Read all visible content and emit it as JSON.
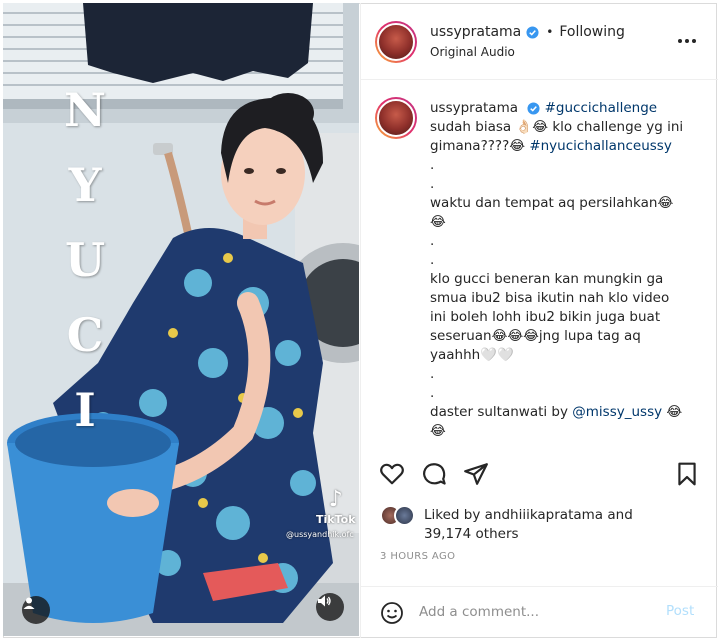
{
  "media": {
    "overlay_letters": [
      "N",
      "Y",
      "U",
      "C",
      "I"
    ],
    "tiktok_label": "TikTok",
    "tiktok_handle": "@ussyandhik.ofc",
    "icons": {
      "user": "user-tag-icon",
      "sound": "sound-icon"
    }
  },
  "header": {
    "username": "ussypratama",
    "separator": "•",
    "follow_label": "Following",
    "audio": "Original Audio",
    "icons": {
      "verified": "verified-badge-icon",
      "more": "more-options-icon"
    }
  },
  "caption": {
    "username": "ussypratama",
    "lines": [
      {
        "parts": [
          {
            "text": "",
            "tag": false
          },
          {
            "text": "#guccichallenge",
            "tag": true
          }
        ]
      },
      {
        "parts": [
          {
            "text": "sudah biasa 👌🏻😂 klo challenge yg ini",
            "tag": false
          }
        ]
      },
      {
        "parts": [
          {
            "text": "gimana????😂 ",
            "tag": false
          },
          {
            "text": "#nyucichallanceussy",
            "tag": true
          }
        ]
      },
      {
        "parts": [
          {
            "text": ".",
            "tag": false
          }
        ]
      },
      {
        "parts": [
          {
            "text": ".",
            "tag": false
          }
        ]
      },
      {
        "parts": [
          {
            "text": "waktu dan tempat aq persilahkan😂",
            "tag": false
          }
        ]
      },
      {
        "parts": [
          {
            "text": "😂",
            "tag": false
          }
        ]
      },
      {
        "parts": [
          {
            "text": ".",
            "tag": false
          }
        ]
      },
      {
        "parts": [
          {
            "text": ".",
            "tag": false
          }
        ]
      },
      {
        "parts": [
          {
            "text": "klo gucci beneran kan mungkin ga",
            "tag": false
          }
        ]
      },
      {
        "parts": [
          {
            "text": "smua ibu2 bisa ikutin nah klo video",
            "tag": false
          }
        ]
      },
      {
        "parts": [
          {
            "text": "ini boleh lohh ibu2 bikin juga buat",
            "tag": false
          }
        ]
      },
      {
        "parts": [
          {
            "text": "seseruan😂😂😂jng lupa tag aq",
            "tag": false
          }
        ]
      },
      {
        "parts": [
          {
            "text": "yaahhh🤍🤍",
            "tag": false
          }
        ]
      },
      {
        "parts": [
          {
            "text": ".",
            "tag": false
          }
        ]
      },
      {
        "parts": [
          {
            "text": ".",
            "tag": false
          }
        ]
      },
      {
        "parts": [
          {
            "text": "daster sultanwati by ",
            "tag": false
          },
          {
            "text": "@missy_ussy",
            "tag": true
          },
          {
            "text": " 😂",
            "tag": false
          }
        ]
      },
      {
        "parts": [
          {
            "text": "😂",
            "tag": false
          }
        ]
      }
    ]
  },
  "actions": {
    "icons": [
      "like-heart-icon",
      "comment-icon",
      "share-icon",
      "save-bookmark-icon"
    ]
  },
  "likes": {
    "prefix": "Liked by ",
    "user": "andhiiikapratama",
    "connector": " and",
    "count_text": "39,174 others"
  },
  "time_ago": "3 HOURS AGO",
  "comment": {
    "placeholder": "Add a comment...",
    "post_label": "Post"
  },
  "colors": {
    "link": "#00376b",
    "verified": "#3897f0",
    "post_disabled": "#b2dffc",
    "muted": "#8e8e8e"
  }
}
